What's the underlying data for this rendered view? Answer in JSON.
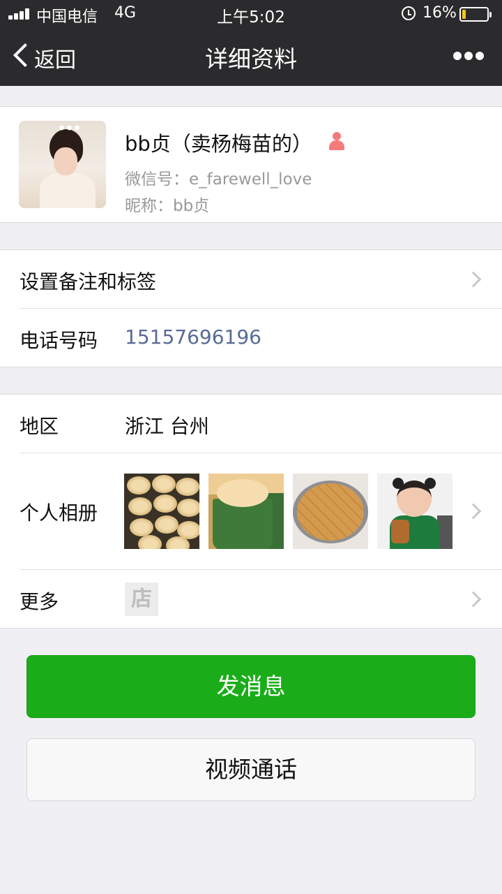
{
  "status_bar": {
    "carrier": "中国电信",
    "network": "4G",
    "time": "上午5:02",
    "battery_percent": "16%",
    "battery_level": 0.16,
    "icons": [
      "signal-icon",
      "alarm-icon",
      "battery-icon"
    ]
  },
  "nav": {
    "back_label": "返回",
    "title": "详细资料",
    "more_icon": "more-icon"
  },
  "profile": {
    "name": "bb贞（卖杨梅苗的）",
    "gender_icon": "female-icon",
    "wechat_id": "微信号：e_farewell_love",
    "nickname": "昵称：bb贞"
  },
  "section_contact": {
    "remark_label": "设置备注和标签",
    "phone_label": "电话号码",
    "phone_value": "15157696196"
  },
  "section_info": {
    "region_label": "地区",
    "region_value": "浙江 台州",
    "album_label": "个人相册",
    "album_thumbnails": [
      "cupcakes-photo",
      "cupcake-closeup-photo",
      "sponge-cake-photo",
      "child-photo"
    ],
    "more_label": "更多",
    "store_icon_text": "店"
  },
  "actions": {
    "send_message": "发消息",
    "video_call": "视频通话"
  },
  "colors": {
    "nav_bg": "#2b2b2d",
    "primary_green": "#1aad19",
    "link_blue": "#576b95",
    "page_bg": "#efeff4",
    "battery_yellow": "#f5c518",
    "gender_pink": "#f37b7b"
  }
}
